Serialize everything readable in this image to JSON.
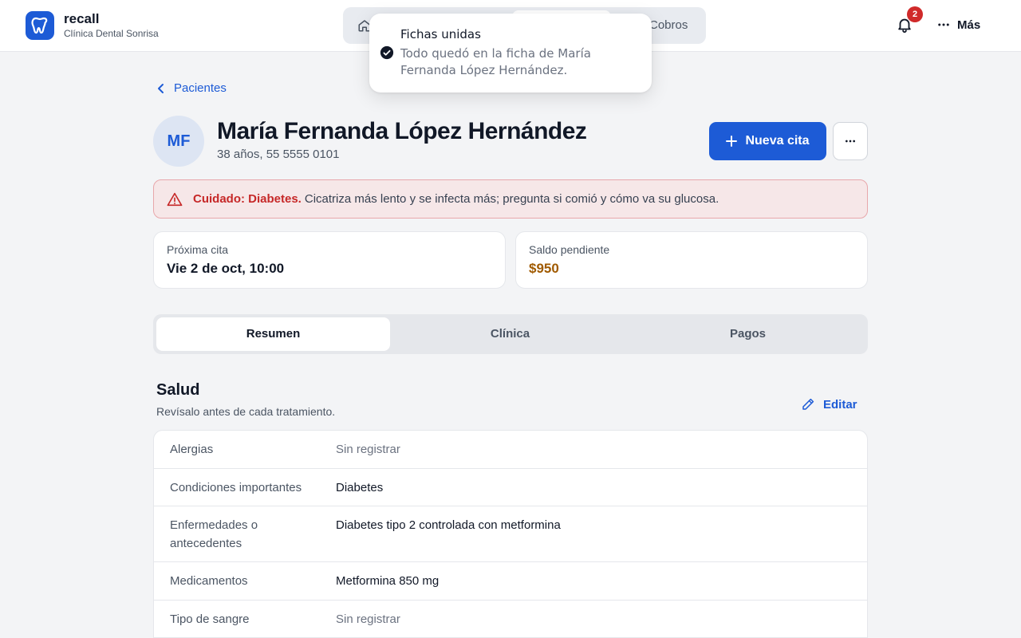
{
  "header": {
    "brand_name": "recall",
    "brand_sub": "Clínica Dental Sonrisa",
    "nav_cobros": "Cobros",
    "notifications_count": "2",
    "more_label": "Más"
  },
  "toast": {
    "title": "Fichas unidas",
    "body": "Todo quedó en la ficha de María Fernanda López Hernández."
  },
  "breadcrumb": {
    "back_label": "Pacientes"
  },
  "patient": {
    "initials": "MF",
    "name": "María Fernanda López Hernández",
    "meta": "38 años, 55 5555 0101",
    "new_appointment_label": "Nueva cita"
  },
  "alert": {
    "strong": "Cuidado: Diabetes.",
    "text": "Cicatriza más lento y se infecta más; pregunta si comió y cómo va su glucosa."
  },
  "cards": {
    "next_label": "Próxima cita",
    "next_value": "Vie 2 de oct, 10:00",
    "balance_label": "Saldo pendiente",
    "balance_value": "$950"
  },
  "tabs": [
    "Resumen",
    "Clínica",
    "Pagos"
  ],
  "health": {
    "title": "Salud",
    "subtitle": "Revísalo antes de cada tratamiento.",
    "edit_label": "Editar",
    "rows": [
      {
        "key": "Alergias",
        "value": "Sin registrar"
      },
      {
        "key": "Condiciones importantes",
        "value": "Diabetes"
      },
      {
        "key": "Enfermedades o antecedentes",
        "value": "Diabetes tipo 2 controlada con metformina"
      },
      {
        "key": "Medicamentos",
        "value": "Metformina 850 mg"
      },
      {
        "key": "Tipo de sangre",
        "value": "Sin registrar"
      }
    ]
  },
  "colors": {
    "accent": "#1d5bd6",
    "danger": "#c62828",
    "money": "#a05a00"
  }
}
